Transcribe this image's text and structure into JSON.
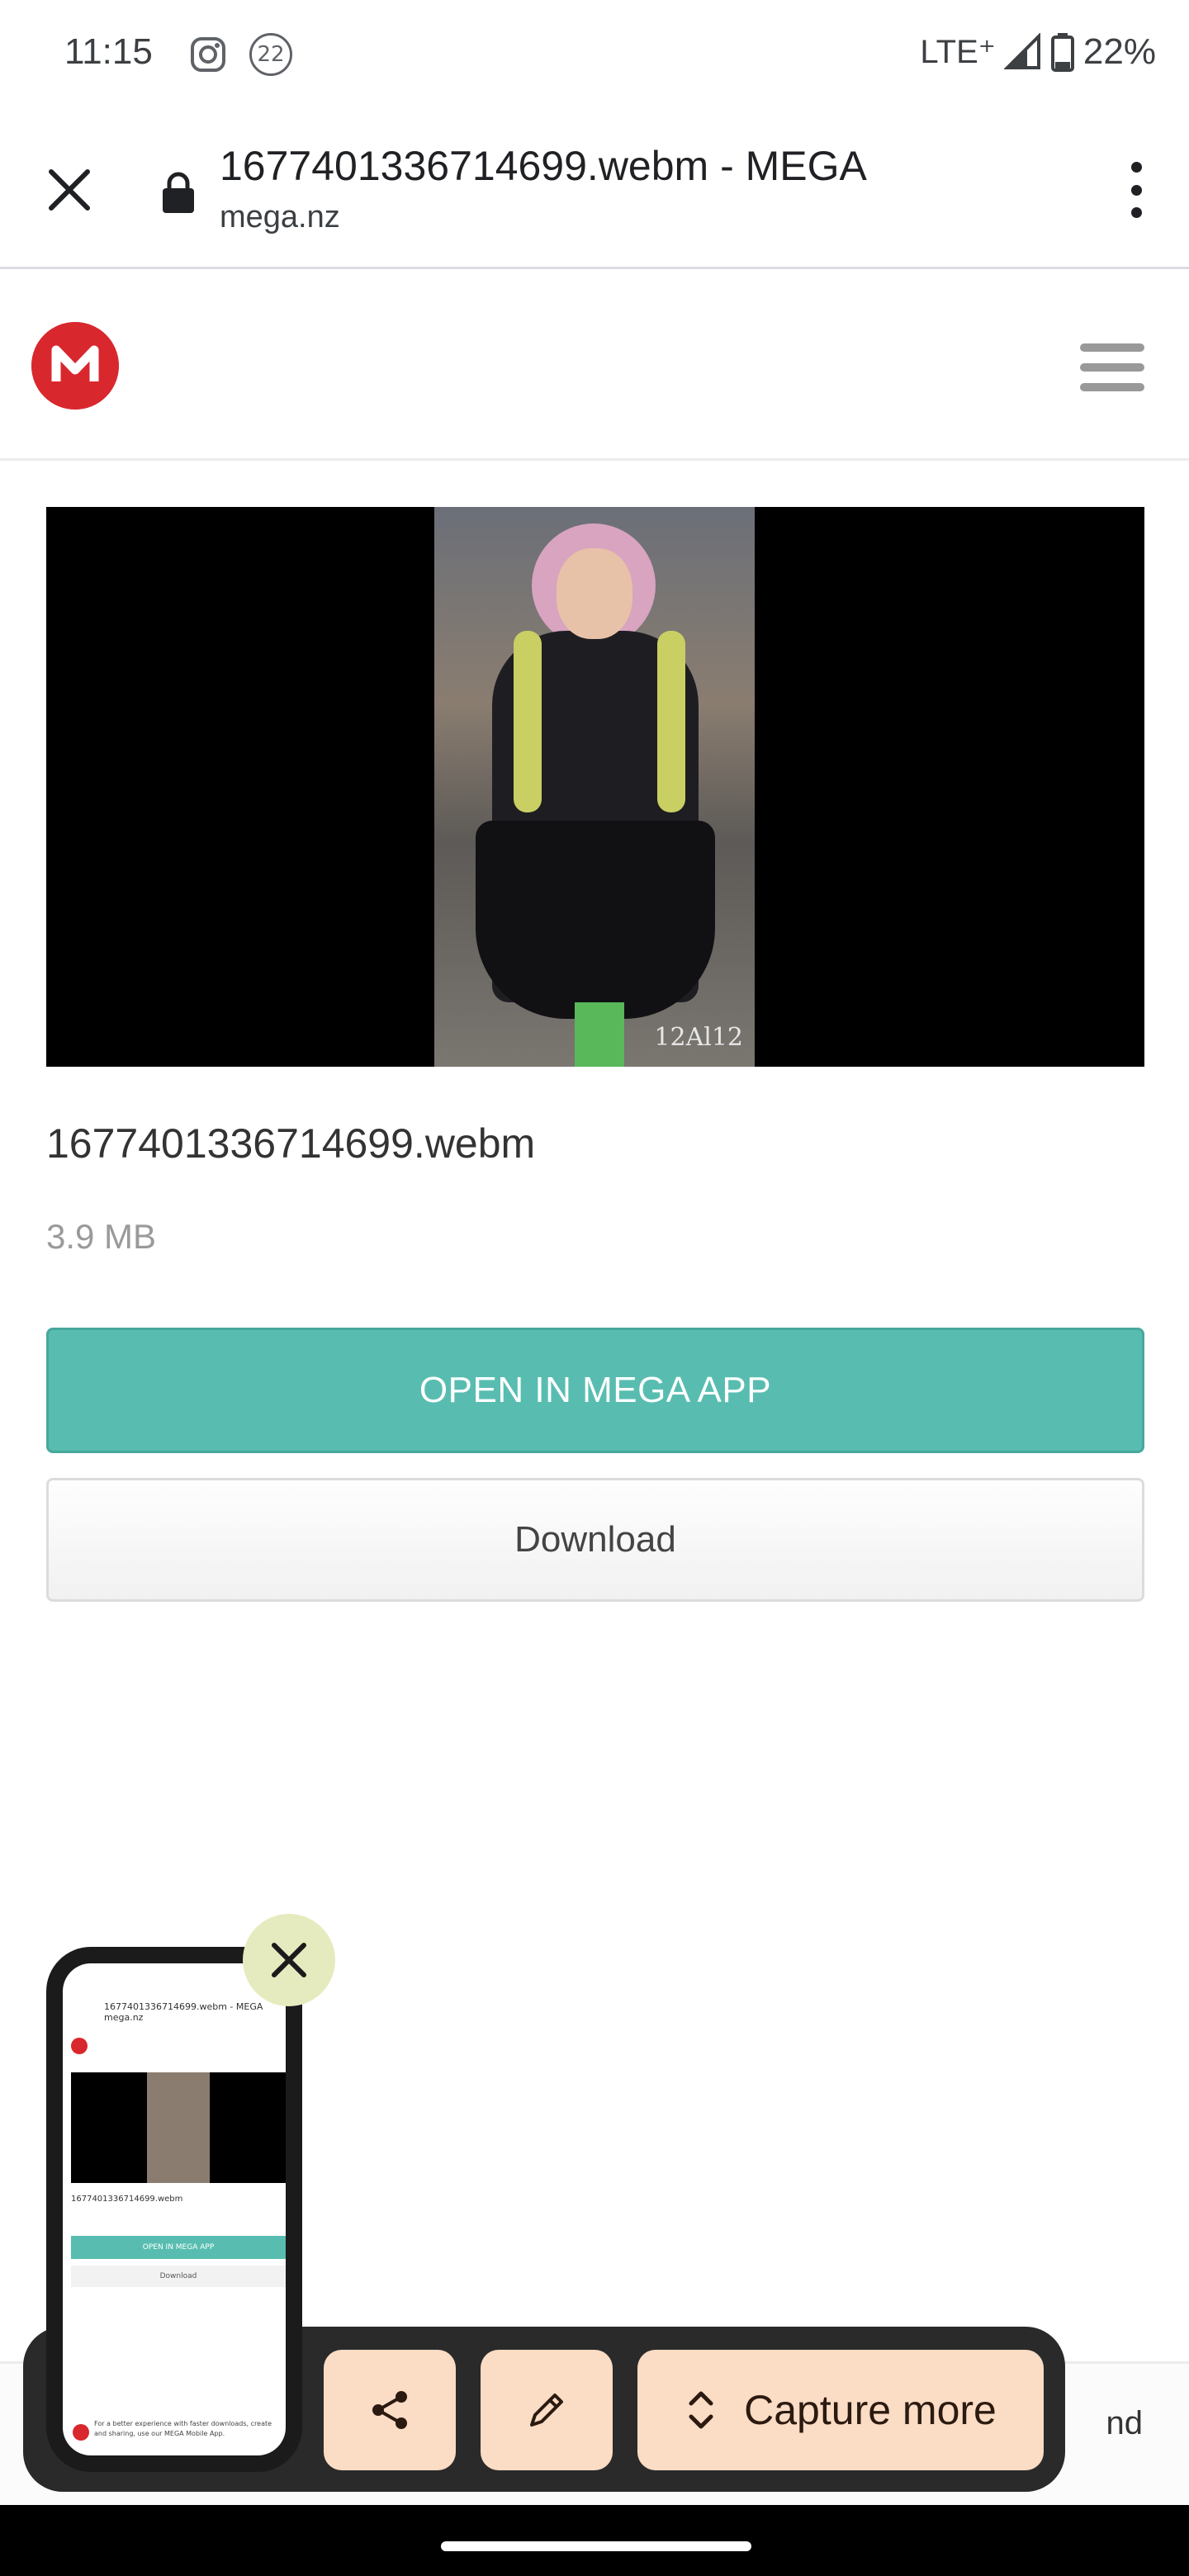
{
  "status_bar": {
    "time": "11:15",
    "notification_count": "22",
    "network": "LTE⁺",
    "battery": "22%",
    "icons": [
      "instagram-icon",
      "notification-count-icon",
      "signal-icon",
      "battery-icon"
    ]
  },
  "browser": {
    "page_title": "1677401336714699.webm - MEGA",
    "url": "mega.nz",
    "icons": [
      "close-icon",
      "lock-icon",
      "more-vert-icon"
    ]
  },
  "site": {
    "logo_letter": "M",
    "logo_color": "#d9272e",
    "menu_icon": "hamburger-icon"
  },
  "video": {
    "watermark": "12Al12"
  },
  "file": {
    "name": "1677401336714699.webm",
    "size": "3.9 MB"
  },
  "buttons": {
    "open_app": "OPEN IN MEGA APP",
    "download": "Download",
    "open_app_color": "#58bdb0"
  },
  "bottom_strip": {
    "visible_text": "nd"
  },
  "capture_toolbar": {
    "capture_more_label": "Capture more",
    "button_color": "#fbdcc5",
    "icons": [
      "share-icon",
      "edit-icon",
      "expand-icon"
    ]
  },
  "thumbnail": {
    "title": "1677401336714699.webm - MEGA",
    "url": "mega.nz",
    "file_name": "1677401336714699.webm",
    "open_app": "OPEN IN MEGA APP",
    "download": "Download",
    "footer_text": "For a better experience with faster downloads, create and sharing, use our MEGA Mobile App."
  }
}
